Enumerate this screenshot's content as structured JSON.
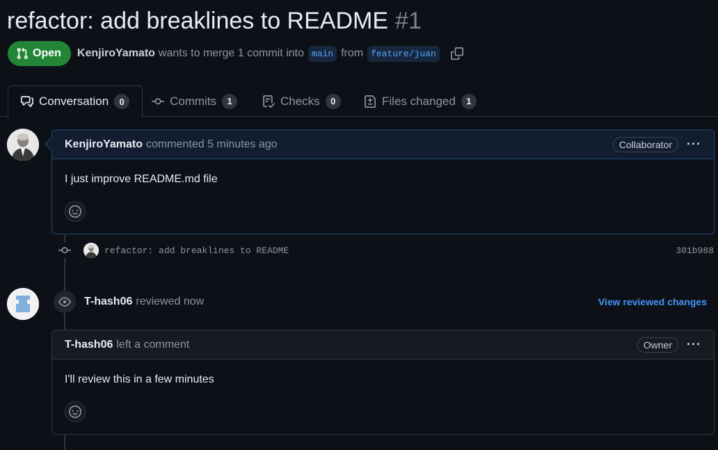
{
  "pr": {
    "title": "refactor: add breaklines to README",
    "number": "#1",
    "state": "Open",
    "author": "KenjiroYamato",
    "merge_text": "wants to merge 1 commit into",
    "base_branch": "main",
    "from_text": "from",
    "head_branch": "feature/juan"
  },
  "tabs": [
    {
      "label": "Conversation",
      "count": "0"
    },
    {
      "label": "Commits",
      "count": "1"
    },
    {
      "label": "Checks",
      "count": "0"
    },
    {
      "label": "Files changed",
      "count": "1"
    }
  ],
  "comment1": {
    "author": "KenjiroYamato",
    "action": "commented 5 minutes ago",
    "role": "Collaborator",
    "menu": "···",
    "body": "I just improve README.md file"
  },
  "commit": {
    "message": "refactor: add breaklines to README",
    "sha": "301b988"
  },
  "review": {
    "author": "T-hash06",
    "action": "reviewed now",
    "link": "View reviewed changes"
  },
  "comment2": {
    "author": "T-hash06",
    "action": "left a comment",
    "role": "Owner",
    "menu": "···",
    "body": "I'll review this in a few minutes"
  },
  "colors": {
    "background": "#0d1117",
    "open_green": "#238636",
    "link_blue": "#4493f8",
    "border": "#30363d"
  }
}
